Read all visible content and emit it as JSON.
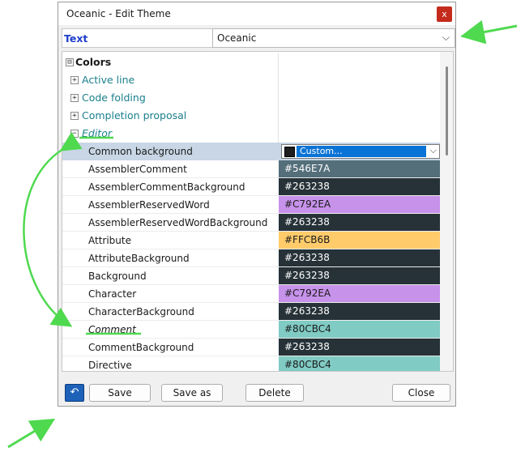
{
  "window": {
    "title": "Oceanic - Edit Theme",
    "close_glyph": "x"
  },
  "text_row": {
    "label": "Text",
    "selected_theme": "Oceanic",
    "chevron": "⌵"
  },
  "tree": {
    "root": {
      "label": "Colors",
      "expander": "⊟"
    },
    "categories": [
      {
        "label": "Active line",
        "expander": "+"
      },
      {
        "label": "Code folding",
        "expander": "+"
      },
      {
        "label": "Completion proposal",
        "expander": "+"
      }
    ],
    "editor": {
      "label": "Editor",
      "expander": "−"
    },
    "selected_item": {
      "name": "Common background",
      "value": "Custom...",
      "swatch_color": "#1e1e1e"
    },
    "items": [
      {
        "name": "AssemblerComment",
        "value": "#546E7A",
        "bg": "#546E7A",
        "fg": "#ffffff"
      },
      {
        "name": "AssemblerCommentBackground",
        "value": "#263238",
        "bg": "#263238",
        "fg": "#ffffff"
      },
      {
        "name": "AssemblerReservedWord",
        "value": "#C792EA",
        "bg": "#C792EA",
        "fg": "#1a1a1a"
      },
      {
        "name": "AssemblerReservedWordBackground",
        "value": "#263238",
        "bg": "#263238",
        "fg": "#ffffff"
      },
      {
        "name": "Attribute",
        "value": "#FFCB6B",
        "bg": "#FFCB6B",
        "fg": "#1a1a1a"
      },
      {
        "name": "AttributeBackground",
        "value": "#263238",
        "bg": "#263238",
        "fg": "#ffffff"
      },
      {
        "name": "Background",
        "value": "#263238",
        "bg": "#263238",
        "fg": "#ffffff"
      },
      {
        "name": "Character",
        "value": "#C792EA",
        "bg": "#C792EA",
        "fg": "#1a1a1a"
      },
      {
        "name": "CharacterBackground",
        "value": "#263238",
        "bg": "#263238",
        "fg": "#ffffff"
      },
      {
        "name": "Comment",
        "value": "#80CBC4",
        "bg": "#80CBC4",
        "fg": "#1a1a1a",
        "italic": true
      },
      {
        "name": "CommentBackground",
        "value": "#263238",
        "bg": "#263238",
        "fg": "#ffffff"
      },
      {
        "name": "Directive",
        "value": "#80CBC4",
        "bg": "#80CBC4",
        "fg": "#1a1a1a"
      }
    ]
  },
  "footer": {
    "back_glyph": "↶",
    "save": "Save",
    "save_as": "Save as",
    "delete": "Delete",
    "close": "Close"
  },
  "colors": {
    "annotation_green": "#4fd94f",
    "link_blue": "#1f3ec9",
    "category_teal": "#1a7f8c"
  }
}
